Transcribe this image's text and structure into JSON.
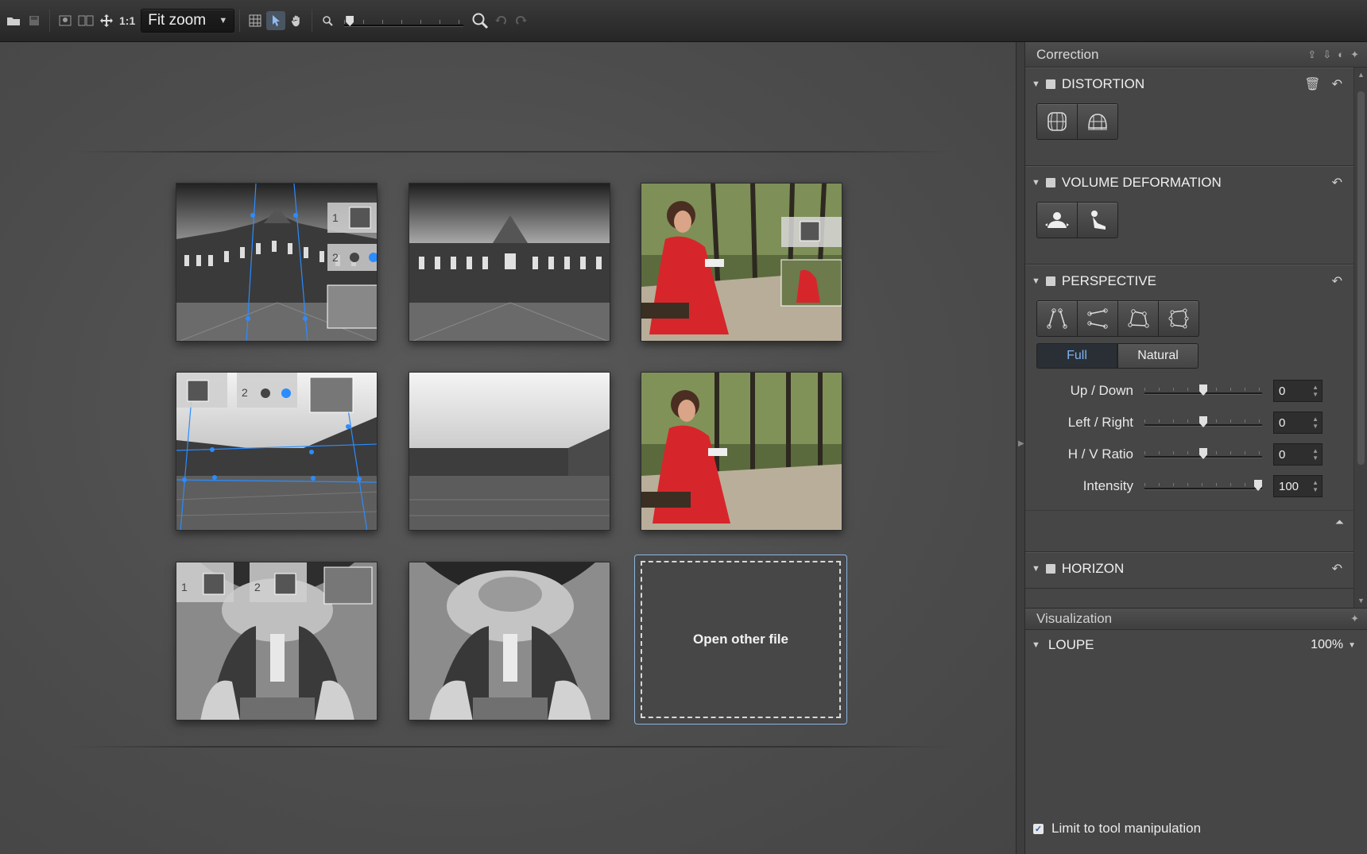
{
  "toolbar": {
    "icons": [
      "open-folder-icon",
      "save-icon",
      "single-view-icon",
      "split-view-icon",
      "move-icon",
      "grid-icon",
      "select-arrow-icon",
      "hand-icon",
      "zoom-out-icon",
      "zoom-in-icon",
      "undo-icon",
      "redo-icon"
    ],
    "one_to_one": "1:1",
    "zoom_value": "Fit zoom",
    "zoom_level": 0.0
  },
  "canvas": {
    "open_file_label": "Open other file",
    "thumbnails": [
      {
        "name": "louvre-facade-with-guides",
        "overlay": [
          "1",
          "2"
        ]
      },
      {
        "name": "louvre-facade-corrected",
        "overlay": []
      },
      {
        "name": "woman-red-dress-with-guides",
        "overlay": []
      },
      {
        "name": "louvre-courtyard-with-guides",
        "overlay": [
          "",
          "2"
        ]
      },
      {
        "name": "louvre-courtyard-corrected",
        "overlay": []
      },
      {
        "name": "woman-red-dress-corrected",
        "overlay": []
      },
      {
        "name": "church-interior-with-guides",
        "overlay": [
          "1",
          "2"
        ]
      },
      {
        "name": "church-interior-corrected",
        "overlay": []
      }
    ]
  },
  "panel": {
    "title": "Correction",
    "sections": {
      "distortion": {
        "title": "DISTORTION"
      },
      "volume": {
        "title": "VOLUME DEFORMATION"
      },
      "perspective": {
        "title": "PERSPECTIVE",
        "mode_full": "Full",
        "mode_natural": "Natural",
        "selected_mode": "Full",
        "sliders": [
          {
            "label": "Up / Down",
            "value": "0",
            "level": 0.5
          },
          {
            "label": "Left / Right",
            "value": "0",
            "level": 0.5
          },
          {
            "label": "H / V Ratio",
            "value": "0",
            "level": 0.5
          },
          {
            "label": "Intensity",
            "value": "100",
            "level": 1.0
          }
        ]
      },
      "horizon": {
        "title": "HORIZON"
      }
    }
  },
  "visualization": {
    "title": "Visualization",
    "loupe_title": "LOUPE",
    "loupe_zoom": "100%",
    "limit_label": "Limit to tool manipulation",
    "limit_checked": true
  },
  "colors": {
    "accent": "#7db4f0",
    "guide_blue": "#2b8cff",
    "dress_red": "#d6262b"
  }
}
